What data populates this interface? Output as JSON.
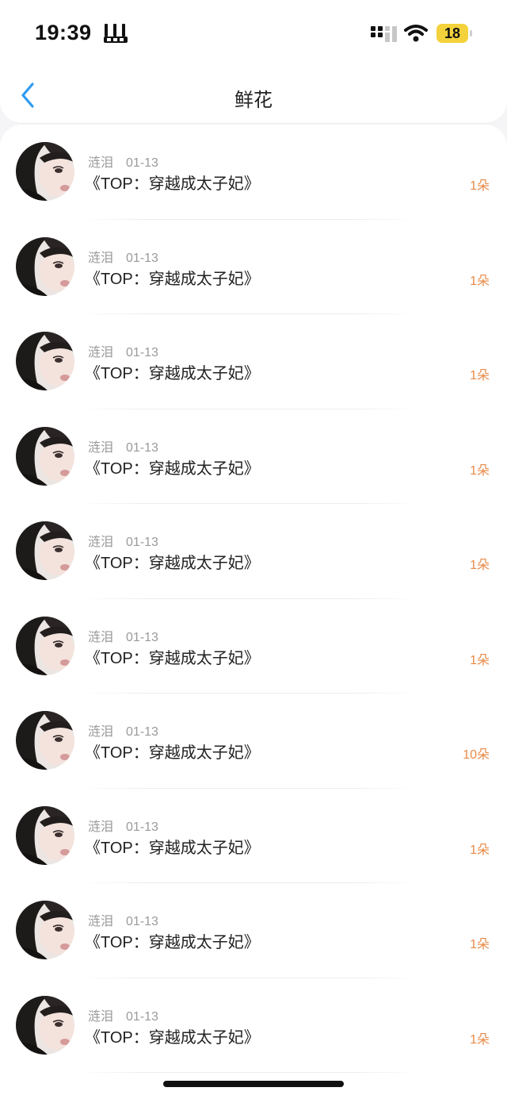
{
  "status_bar": {
    "time": "19:39",
    "battery_level": "18"
  },
  "nav": {
    "title": "鲜花"
  },
  "records": [
    {
      "user": "涟泪",
      "date": "01-13",
      "book": "《TOP：穿越成太子妃》",
      "flowers": "1朵"
    },
    {
      "user": "涟泪",
      "date": "01-13",
      "book": "《TOP：穿越成太子妃》",
      "flowers": "1朵"
    },
    {
      "user": "涟泪",
      "date": "01-13",
      "book": "《TOP：穿越成太子妃》",
      "flowers": "1朵"
    },
    {
      "user": "涟泪",
      "date": "01-13",
      "book": "《TOP：穿越成太子妃》",
      "flowers": "1朵"
    },
    {
      "user": "涟泪",
      "date": "01-13",
      "book": "《TOP：穿越成太子妃》",
      "flowers": "1朵"
    },
    {
      "user": "涟泪",
      "date": "01-13",
      "book": "《TOP：穿越成太子妃》",
      "flowers": "1朵"
    },
    {
      "user": "涟泪",
      "date": "01-13",
      "book": "《TOP：穿越成太子妃》",
      "flowers": "10朵"
    },
    {
      "user": "涟泪",
      "date": "01-13",
      "book": "《TOP：穿越成太子妃》",
      "flowers": "1朵"
    },
    {
      "user": "涟泪",
      "date": "01-13",
      "book": "《TOP：穿越成太子妃》",
      "flowers": "1朵"
    },
    {
      "user": "涟泪",
      "date": "01-13",
      "book": "《TOP：穿越成太子妃》",
      "flowers": "1朵"
    }
  ],
  "colors": {
    "accent": "#2f9bf0",
    "flower_count": "#e88a48",
    "battery": "#f3d23b"
  },
  "icons": {
    "back": "chevron-left-icon",
    "signal": "cellular-signal-icon",
    "wifi": "wifi-icon",
    "battery": "battery-icon"
  }
}
